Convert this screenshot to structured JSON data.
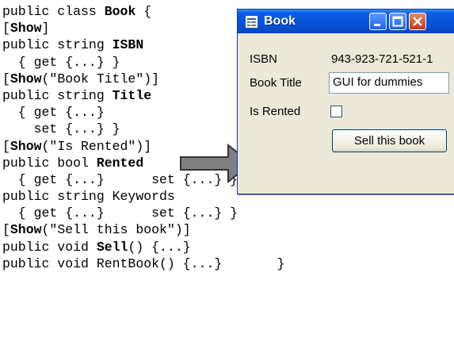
{
  "code": {
    "lines": [
      [
        {
          "t": "public class "
        },
        {
          "t": "Book",
          "b": true
        },
        {
          "t": " {"
        }
      ],
      [
        {
          "t": "["
        },
        {
          "t": "Show",
          "b": true
        },
        {
          "t": "]"
        }
      ],
      [
        {
          "t": "public string "
        },
        {
          "t": "ISBN",
          "b": true
        }
      ],
      [
        {
          "t": "  { get {...} }"
        }
      ],
      [
        {
          "t": "["
        },
        {
          "t": "Show",
          "b": true
        },
        {
          "t": "(\"Book Title\")]"
        }
      ],
      [
        {
          "t": "public string "
        },
        {
          "t": "Title",
          "b": true
        }
      ],
      [
        {
          "t": "  { get {...}"
        }
      ],
      [
        {
          "t": "    set {...} }"
        }
      ],
      [
        {
          "t": "["
        },
        {
          "t": "Show",
          "b": true
        },
        {
          "t": "(\"Is Rented\")]"
        }
      ],
      [
        {
          "t": "public bool "
        },
        {
          "t": "Rented",
          "b": true
        }
      ],
      [
        {
          "t": "  { get {...}      set {...} }"
        }
      ],
      [
        {
          "t": "public string Keywords"
        }
      ],
      [
        {
          "t": "  { get {...}      set {...} }"
        }
      ],
      [
        {
          "t": "["
        },
        {
          "t": "Show",
          "b": true
        },
        {
          "t": "(\"Sell this book\")]"
        }
      ],
      [
        {
          "t": "public void "
        },
        {
          "t": "Sell",
          "b": true
        },
        {
          "t": "() {...}"
        }
      ],
      [
        {
          "t": "public void RentBook() {...}       }"
        }
      ]
    ]
  },
  "window": {
    "title": "Book",
    "fields": [
      {
        "label": "ISBN",
        "value": "943-923-721-521-1"
      },
      {
        "label": "Book Title",
        "value": "GUI for dummies"
      },
      {
        "label": "Is Rented",
        "checked": false
      }
    ],
    "button_label": "Sell this book"
  },
  "colors": {
    "titlebar": "#0552d6",
    "window_bg": "#ece9d8",
    "arrow_fill": "#808080"
  },
  "icons": [
    "app-form-icon",
    "minimize-icon",
    "maximize-icon",
    "close-icon",
    "arrow-right-icon"
  ]
}
